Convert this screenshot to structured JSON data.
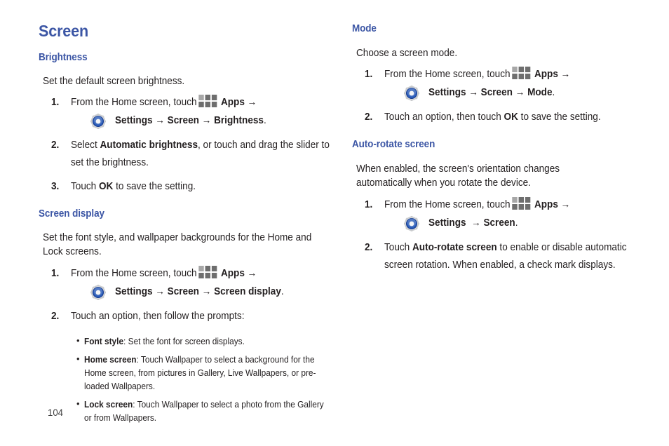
{
  "document": {
    "page_number": "104",
    "heading_color": "#3c56a5",
    "text_color": "#231f20"
  },
  "icons": {
    "apps": "apps-grid-icon",
    "settings": "settings-gear-icon",
    "arrow": "→"
  },
  "left_column": {
    "title": "Screen",
    "sections": [
      {
        "heading": "Brightness",
        "intro": "Set the default screen brightness.",
        "steps": [
          {
            "num": "1.",
            "line1_pre": "From the Home screen, touch",
            "line1_apps": "Apps",
            "line2_settings": "Settings",
            "line2_path1": "Screen",
            "line2_path2": "Brightness",
            "line2_end": "."
          },
          {
            "num": "2.",
            "pre": "Select ",
            "bold": "Automatic brightness",
            "post": ", or touch and drag the slider to set the brightness."
          },
          {
            "num": "3.",
            "pre": "Touch ",
            "bold": "OK",
            "post": " to save the setting."
          }
        ]
      },
      {
        "heading": "Screen display",
        "intro": "Set the font style, and wallpaper backgrounds for the Home and Lock screens.",
        "steps": [
          {
            "num": "1.",
            "line1_pre": "From the Home screen, touch",
            "line1_apps": "Apps",
            "line2_settings": "Settings",
            "line2_path1": "Screen",
            "line2_path2": "Screen display",
            "line2_end": "."
          },
          {
            "num": "2.",
            "pre": "Touch an option, then follow the prompts:",
            "bold": "",
            "post": ""
          }
        ],
        "bullets": [
          {
            "term": "Font style",
            "desc": ": Set the font for screen displays."
          },
          {
            "term": "Home screen",
            "desc": ": Touch Wallpaper to select a background for the Home screen, from pictures in Gallery, Live Wallpapers, or pre-loaded Wallpapers."
          },
          {
            "term": "Lock screen",
            "desc": ": Touch Wallpaper to select a photo from the Gallery or from Wallpapers."
          }
        ]
      }
    ]
  },
  "right_column": {
    "sections": [
      {
        "heading": "Mode",
        "intro": "Choose a screen mode.",
        "steps": [
          {
            "num": "1.",
            "line1_pre": "From the Home screen, touch",
            "line1_apps": "Apps",
            "line2_settings": "Settings",
            "line2_path1": "Screen",
            "line2_path2": "Mode",
            "line2_end": "."
          },
          {
            "num": "2.",
            "pre": "Touch an option, then touch ",
            "bold": "OK",
            "post": " to save the setting."
          }
        ]
      },
      {
        "heading": "Auto-rotate screen",
        "intro": "When enabled, the screen's orientation changes automatically when you rotate the device.",
        "steps": [
          {
            "num": "1.",
            "line1_pre": "From the Home screen, touch",
            "line1_apps": "Apps",
            "line2_settings": "Settings",
            "line2_path1": "Screen",
            "line2_path2": "",
            "line2_end": "."
          },
          {
            "num": "2.",
            "pre": "Touch ",
            "bold": "Auto-rotate screen",
            "post": " to enable or disable automatic screen rotation. When enabled, a check mark displays."
          }
        ]
      }
    ]
  }
}
